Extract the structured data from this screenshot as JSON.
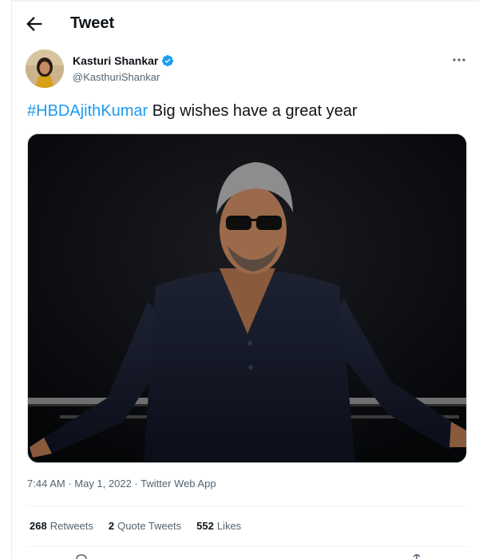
{
  "header": {
    "title": "Tweet"
  },
  "author": {
    "name": "Kasturi Shankar",
    "handle": "@KasthuriShankar"
  },
  "tweet": {
    "hashtag": "#HBDAjithKumar",
    "text": " Big wishes have a great year"
  },
  "meta": {
    "time": "7:44 AM",
    "separator": " · ",
    "date": "May 1, 2022",
    "source": "Twitter Web App"
  },
  "stats": {
    "retweets_count": "268",
    "retweets_label": "Retweets",
    "quotes_count": "2",
    "quotes_label": "Quote Tweets",
    "likes_count": "552",
    "likes_label": "Likes"
  },
  "colors": {
    "accent": "#1d9bf0",
    "text": "#0f1419",
    "muted": "#536471",
    "divider": "#eff3f4"
  }
}
